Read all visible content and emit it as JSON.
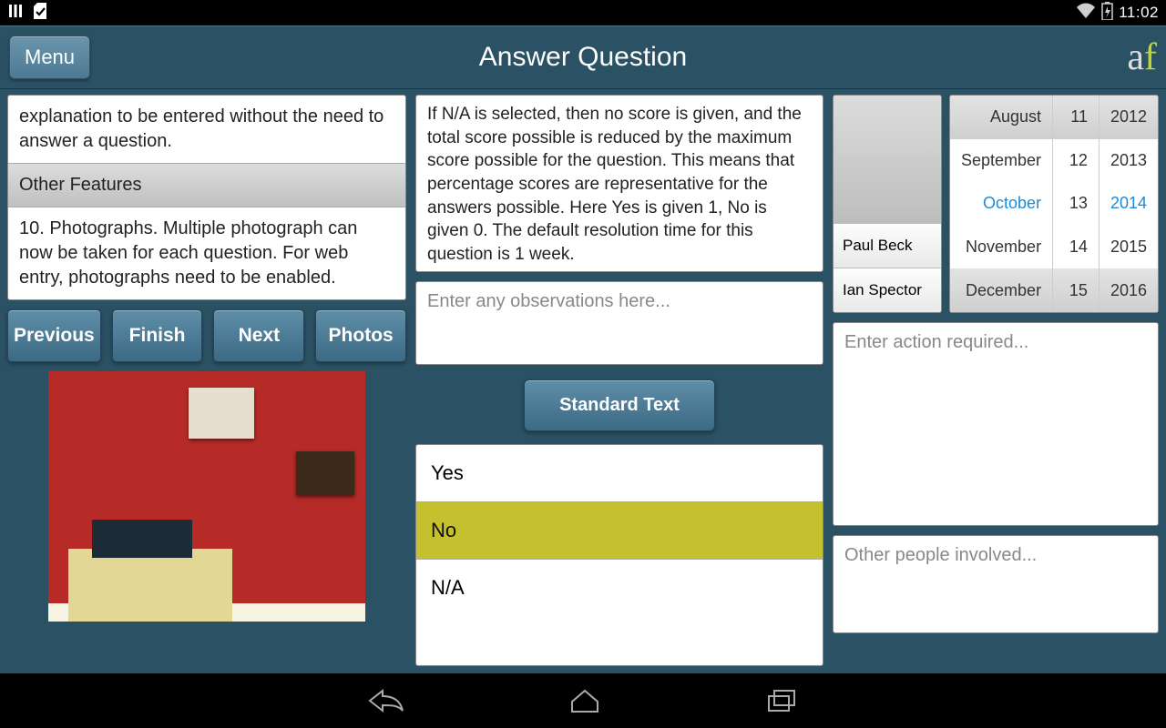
{
  "status": {
    "time": "11:02"
  },
  "header": {
    "menu_label": "Menu",
    "title": "Answer Question",
    "brand_a": "a",
    "brand_f": "f"
  },
  "left": {
    "truncated_text": "explanation to be entered without the need to answer a question.",
    "section_header": "Other Features",
    "body": "10. Photographs.  Multiple photograph can now be taken for each question.  For web entry, photographs need to be enabled.",
    "buttons": {
      "previous": "Previous",
      "finish": "Finish",
      "next": "Next",
      "photos": "Photos"
    }
  },
  "mid": {
    "info": "If N/A is selected, then no score is given, and the total score possible is reduced by the maximum score possible for the question. This means that percentage scores are representative for the answers possible. Here Yes is given 1, No is given 0.  The default resolution time for this question is 1 week.",
    "obs_placeholder": "Enter any observations here...",
    "standard_text": "Standard Text",
    "answers": {
      "yes": "Yes",
      "no": "No",
      "na": "N/A"
    }
  },
  "right": {
    "people": {
      "p1": "Paul Beck",
      "p2": "Ian Spector"
    },
    "date": {
      "months": [
        "August",
        "September",
        "October",
        "November",
        "December"
      ],
      "days": [
        "11",
        "12",
        "13",
        "14",
        "15"
      ],
      "years": [
        "2012",
        "2013",
        "2014",
        "2015",
        "2016"
      ],
      "selected_month": "October",
      "selected_day": "13",
      "selected_year": "2014"
    },
    "action_placeholder": "Enter action required...",
    "people_placeholder": "Other people involved..."
  }
}
